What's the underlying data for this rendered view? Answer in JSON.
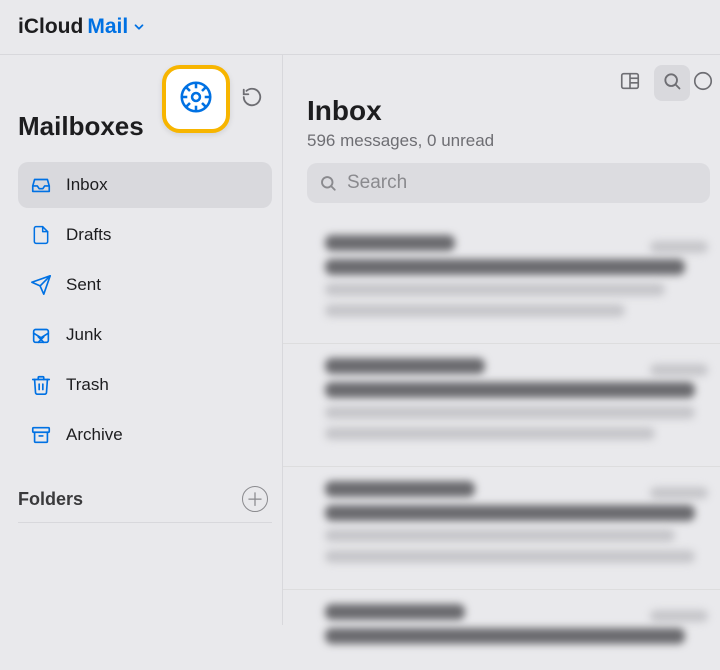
{
  "brand": {
    "prefix": "iCloud",
    "product": "Mail"
  },
  "sidebar": {
    "title": "Mailboxes",
    "items": [
      {
        "label": "Inbox",
        "icon": "inbox-icon",
        "active": true
      },
      {
        "label": "Drafts",
        "icon": "drafts-icon",
        "active": false
      },
      {
        "label": "Sent",
        "icon": "sent-icon",
        "active": false
      },
      {
        "label": "Junk",
        "icon": "junk-icon",
        "active": false
      },
      {
        "label": "Trash",
        "icon": "trash-icon",
        "active": false
      },
      {
        "label": "Archive",
        "icon": "archive-icon",
        "active": false
      }
    ],
    "folders_label": "Folders"
  },
  "main": {
    "title": "Inbox",
    "subtitle": "596 messages, 0 unread",
    "search_placeholder": "Search"
  }
}
